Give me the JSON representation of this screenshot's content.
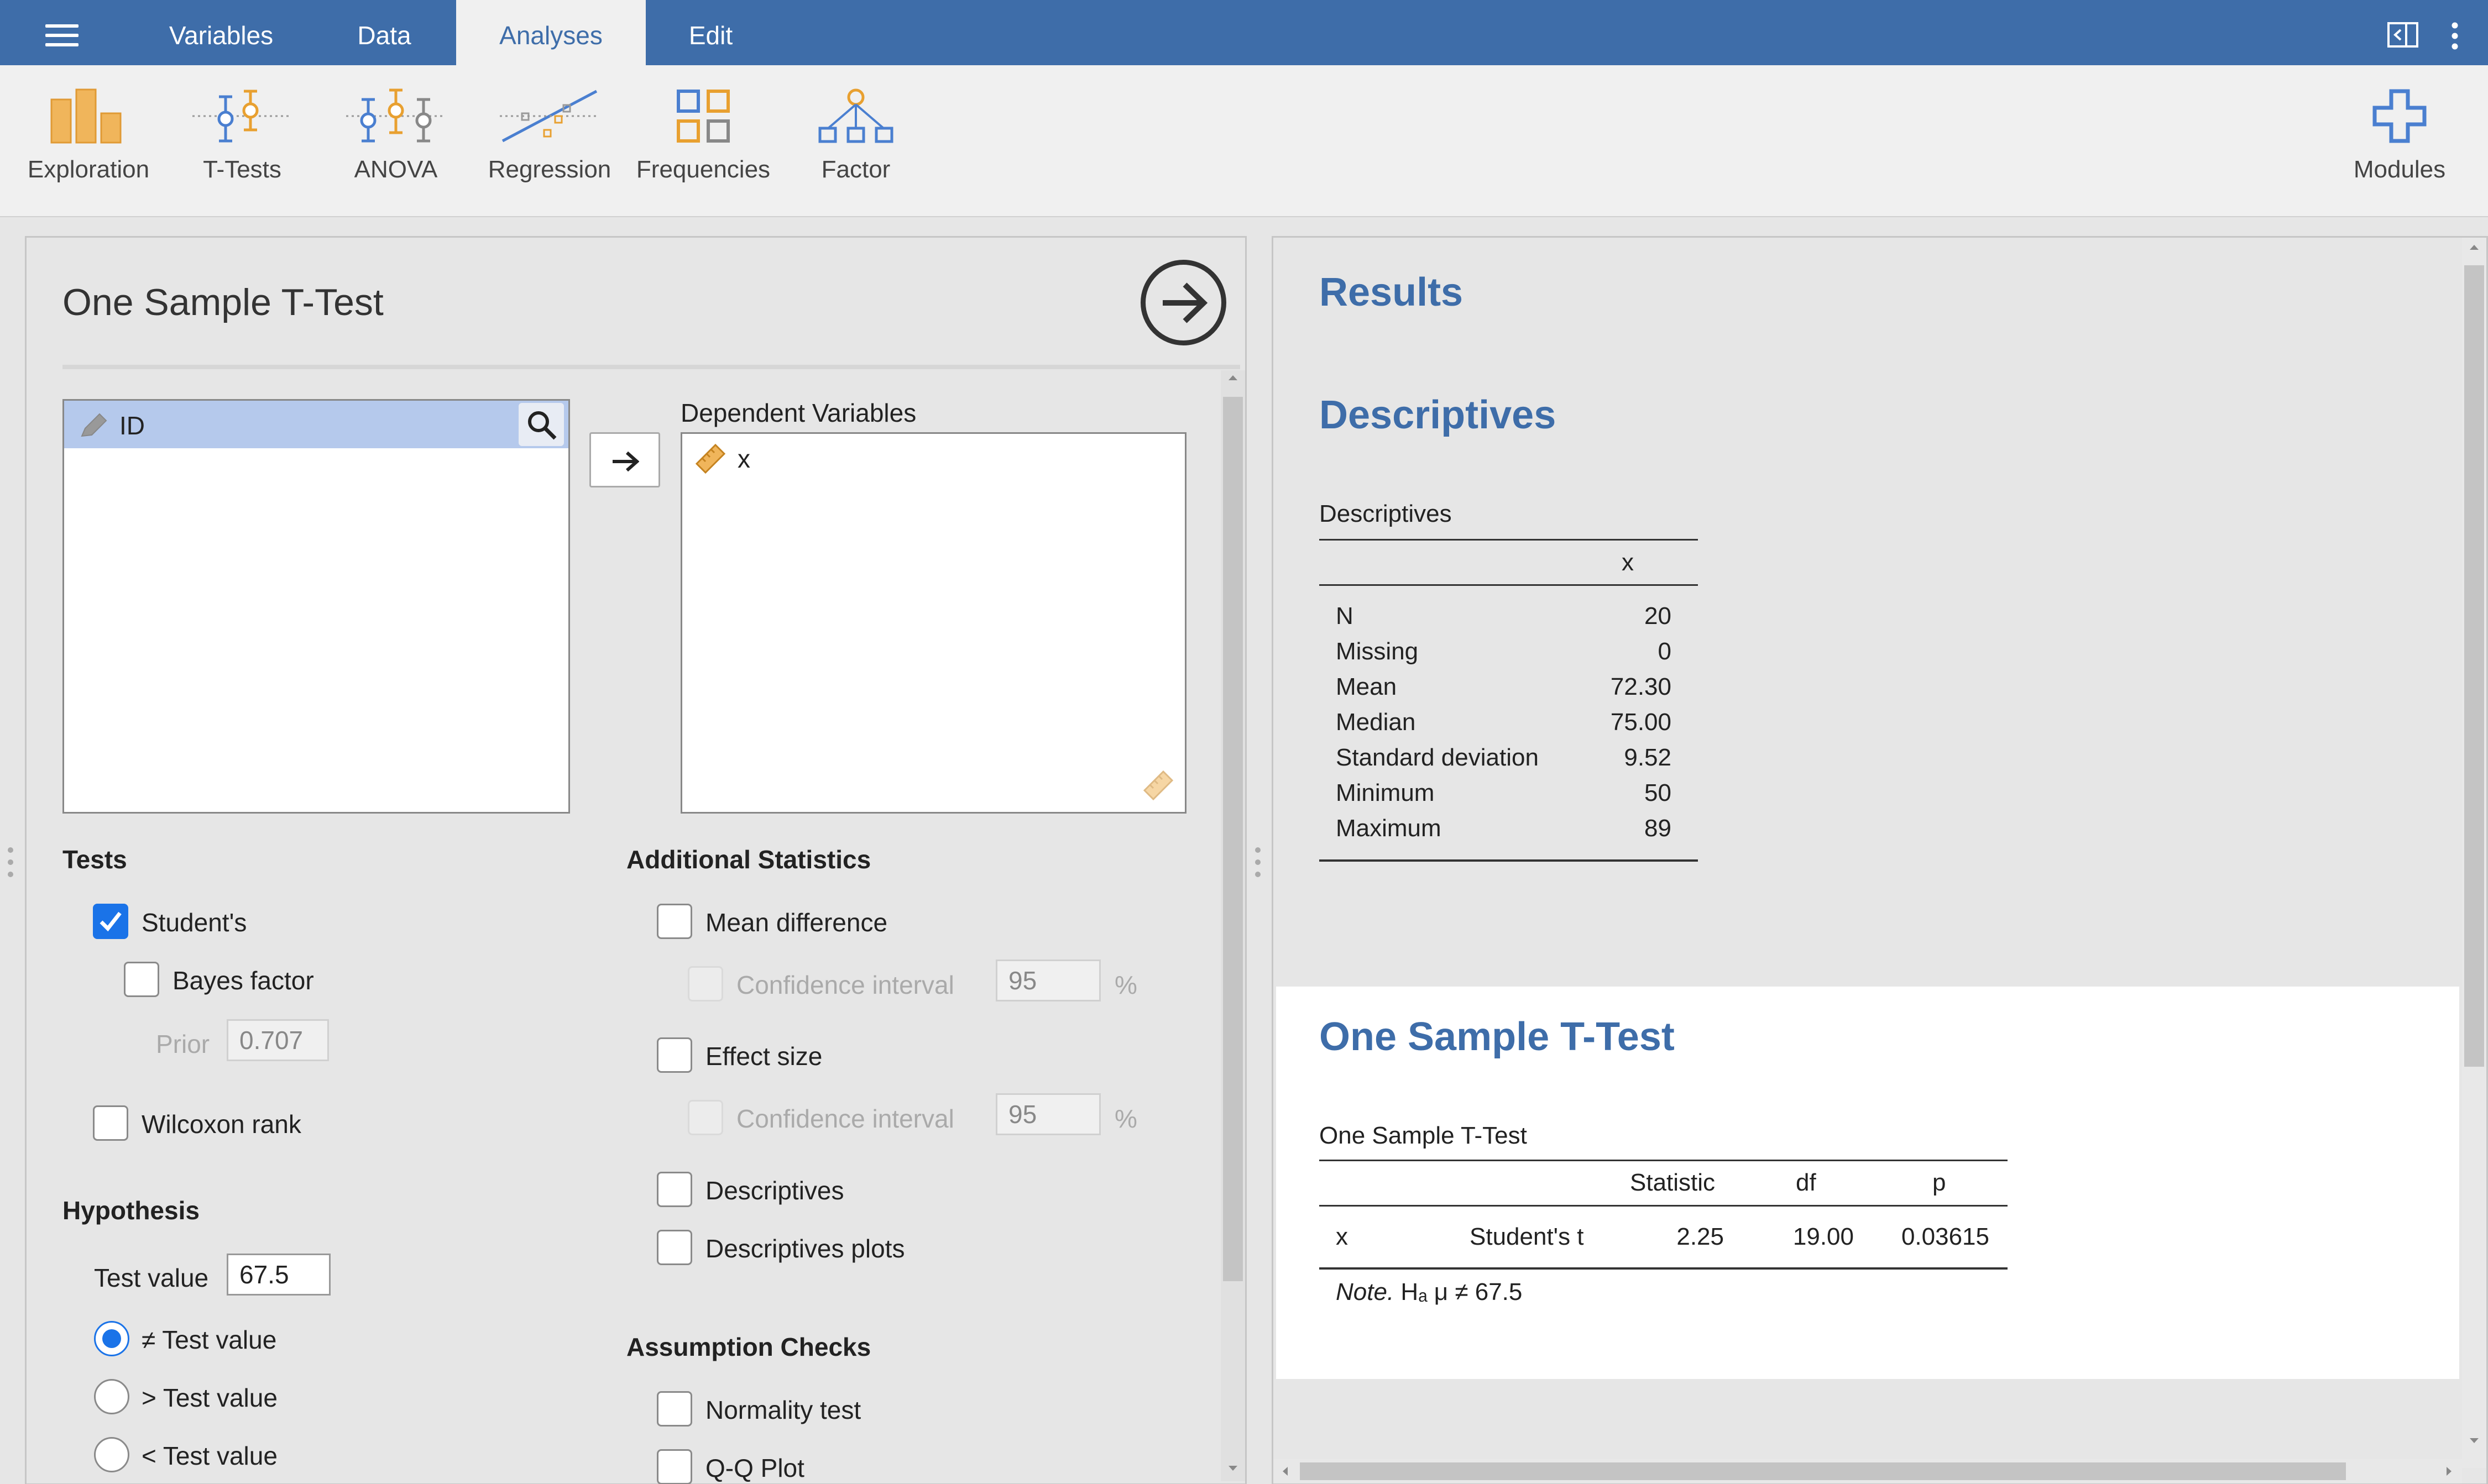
{
  "topbar": {
    "menu_icon": "hamburger-menu-icon",
    "tabs": [
      {
        "label": "Variables"
      },
      {
        "label": "Data"
      },
      {
        "label": "Analyses"
      },
      {
        "label": "Edit"
      }
    ],
    "active_tab": "Analyses",
    "right_icons": [
      "view-mode-icon",
      "more-vertical-icon"
    ]
  },
  "ribbon": {
    "buttons": [
      {
        "label": "Exploration",
        "icon": "exploration-bar-chart-icon"
      },
      {
        "label": "T-Tests",
        "icon": "t-tests-icon"
      },
      {
        "label": "ANOVA",
        "icon": "anova-icon"
      },
      {
        "label": "Regression",
        "icon": "regression-icon"
      },
      {
        "label": "Frequencies",
        "icon": "frequencies-grid-icon"
      },
      {
        "label": "Factor",
        "icon": "factor-tree-icon"
      }
    ],
    "modules_label": "Modules"
  },
  "options": {
    "title": "One Sample T-Test",
    "available_vars": [
      {
        "name": "ID",
        "icon": "nominal-pencil-icon",
        "selected": true
      }
    ],
    "dependent_label": "Dependent Variables",
    "dependent_vars": [
      {
        "name": "x",
        "icon": "continuous-ruler-icon"
      }
    ],
    "tests": {
      "header": "Tests",
      "students": {
        "label": "Student's",
        "checked": true
      },
      "bayes": {
        "label": "Bayes factor",
        "checked": false
      },
      "prior_label": "Prior",
      "prior_value": "0.707",
      "wilcoxon": {
        "label": "Wilcoxon rank",
        "checked": false
      }
    },
    "hypothesis": {
      "header": "Hypothesis",
      "test_value_label": "Test value",
      "test_value": "67.5",
      "options": [
        {
          "label": "≠ Test value",
          "selected": true
        },
        {
          "label": "> Test value",
          "selected": false
        },
        {
          "label": "< Test value",
          "selected": false
        }
      ]
    },
    "additional": {
      "header": "Additional Statistics",
      "mean_diff": "Mean difference",
      "ci_label": "Confidence interval",
      "ci_value": "95",
      "ci_unit": "%",
      "effect_size": "Effect size",
      "ci2_label": "Confidence interval",
      "ci2_value": "95",
      "ci2_unit": "%",
      "descriptives": "Descriptives",
      "descriptives_plots": "Descriptives plots"
    },
    "assumptions": {
      "header": "Assumption Checks",
      "normality": "Normality test",
      "qq": "Q-Q Plot"
    }
  },
  "results": {
    "title": "Results",
    "descriptives": {
      "heading": "Descriptives",
      "caption": "Descriptives",
      "column": "x",
      "rows": [
        {
          "label": "N",
          "value": "20"
        },
        {
          "label": "Missing",
          "value": "0"
        },
        {
          "label": "Mean",
          "value": "72.30"
        },
        {
          "label": "Median",
          "value": "75.00"
        },
        {
          "label": "Standard deviation",
          "value": "9.52"
        },
        {
          "label": "Minimum",
          "value": "50"
        },
        {
          "label": "Maximum",
          "value": "89"
        }
      ]
    },
    "ttest": {
      "heading": "One Sample T-Test",
      "caption": "One Sample T-Test",
      "headers": {
        "statistic": "Statistic",
        "df": "df",
        "p": "p"
      },
      "row": {
        "var": "x",
        "test": "Student's t",
        "statistic": "2.25",
        "df": "19.00",
        "p": "0.03615"
      },
      "note_label": "Note.",
      "note_text": "Hₐ μ ≠ 67.5"
    }
  }
}
